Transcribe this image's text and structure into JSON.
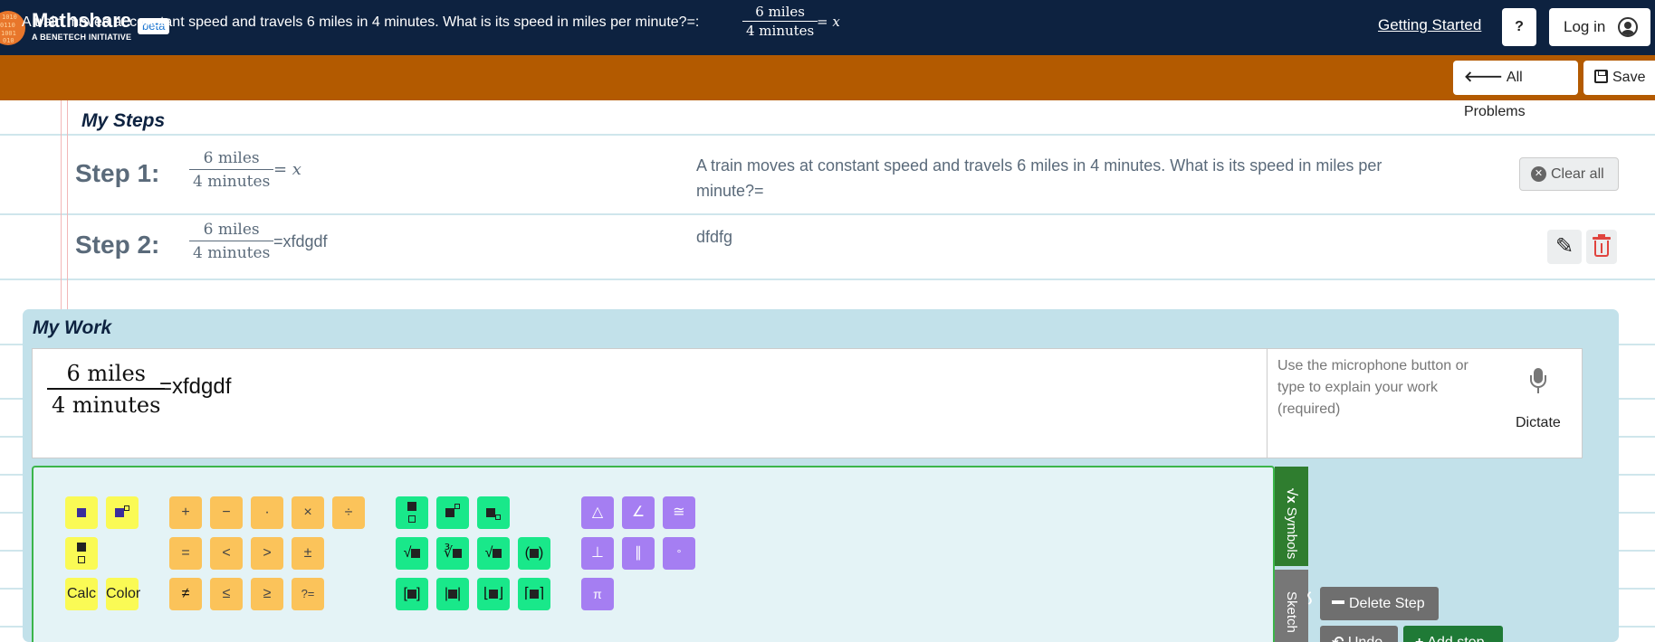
{
  "header": {
    "brand": "Mathshare",
    "brand_sub": "A BENETECH INITIATIVE",
    "badge": "beta",
    "getting_started": "Getting Started",
    "help": "?",
    "login": "Log in"
  },
  "problem": {
    "text": "A train moves at constant speed and travels 6 miles in 4 minutes. What is its speed in miles per minute?=:",
    "numerator": "6 miles",
    "denominator": "4 minutes",
    "equals_x": "= x",
    "all_problems": "All Problems",
    "save": "Save"
  },
  "steps": {
    "title": "My Steps",
    "items": [
      {
        "label": "Step 1:",
        "numerator": "6 miles",
        "denominator": "4 minutes",
        "rest": "= x",
        "description": "A train moves at constant speed and travels 6 miles in 4 minutes. What is its speed in miles per minute?="
      },
      {
        "label": "Step 2:",
        "numerator": "6 miles",
        "denominator": "4 minutes",
        "rest": "=xfdgdf",
        "description": "dfdfg"
      }
    ],
    "clear_all": "Clear all"
  },
  "work": {
    "title": "My Work",
    "numerator": "6 miles",
    "denominator": "4 minutes",
    "rest": "=xfdgdf",
    "explain_placeholder": "Use the microphone button or type to explain your work (required)",
    "dictate": "Dictate"
  },
  "keyboard": {
    "calc": "Calc",
    "color": "Color",
    "ops": [
      "+",
      "−",
      "·",
      "×",
      "÷",
      "=",
      "<",
      ">",
      "±",
      "≠",
      "≤",
      "≥",
      "?="
    ],
    "geometry": [
      "△",
      "∠",
      "≅",
      "⊥",
      "∥",
      "°",
      "π"
    ],
    "tabs": {
      "symbols": "Symbols",
      "sketch": "Sketch"
    }
  },
  "actions": {
    "delete_step": "Delete Step",
    "undo": "Undo",
    "add_step": "Add step"
  },
  "colors": {
    "header_bg": "#0d2240",
    "problem_bar": "#b35a00",
    "work_panel": "#c2e1ea",
    "key_yellow": "#fafa55",
    "key_orange": "#fbc35a",
    "key_green": "#19e88a",
    "key_purple": "#a57ef2"
  }
}
